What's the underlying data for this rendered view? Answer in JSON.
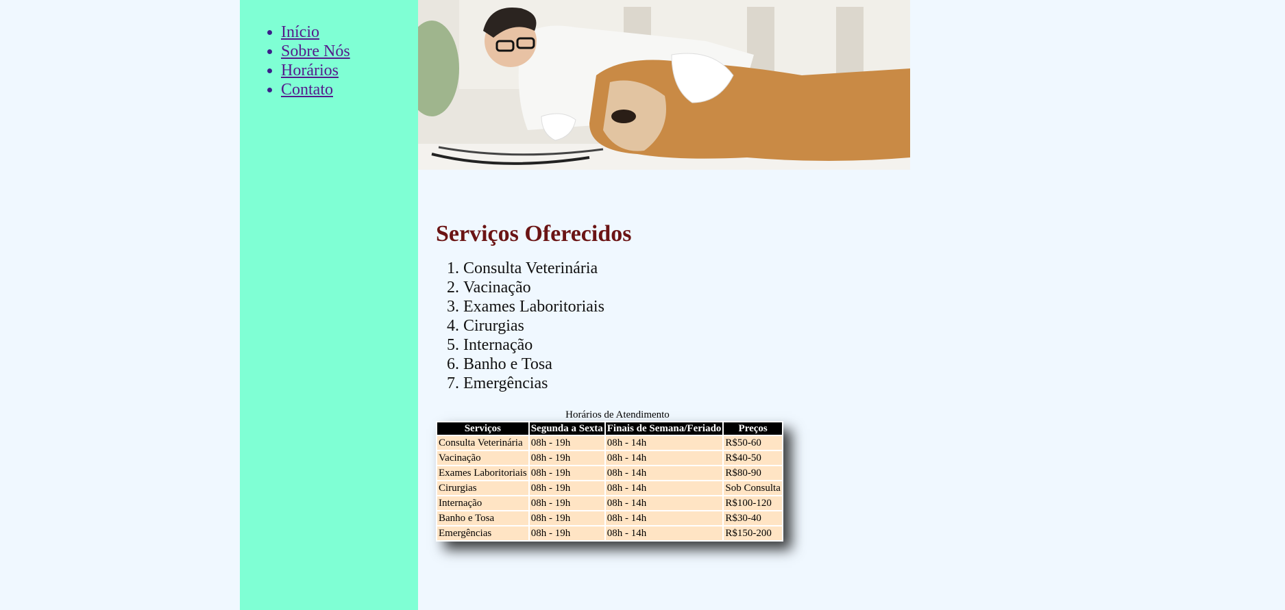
{
  "nav": {
    "items": [
      {
        "label": "Início"
      },
      {
        "label": "Sobre Nós"
      },
      {
        "label": "Horários"
      },
      {
        "label": "Contato"
      }
    ]
  },
  "colors": {
    "sidebar": "#7fffd4",
    "page_background": "#f0f8ff",
    "heading": "#6b1414",
    "table_header": "#000000",
    "table_cell": "#ffe4c4"
  },
  "services": {
    "title": "Serviços Oferecidos",
    "items": [
      "Consulta Veterinária",
      "Vacinação",
      "Exames Laboritoriais",
      "Cirurgias",
      "Internação",
      "Banho e Tosa",
      "Emergências"
    ]
  },
  "schedule": {
    "caption": "Horários de Atendimento",
    "headers": [
      "Serviços",
      "Segunda a Sexta",
      "Finais de Semana/Feriado",
      "Preços"
    ],
    "rows": [
      [
        "Consulta Veterinária",
        "08h - 19h",
        "08h - 14h",
        "R$50-60"
      ],
      [
        "Vacinação",
        "08h - 19h",
        "08h - 14h",
        "R$40-50"
      ],
      [
        "Exames Laboritoriais",
        "08h - 19h",
        "08h - 14h",
        "R$80-90"
      ],
      [
        "Cirurgias",
        "08h - 19h",
        "08h - 14h",
        "Sob Consulta"
      ],
      [
        "Internação",
        "08h - 19h",
        "08h - 14h",
        "R$100-120"
      ],
      [
        "Banho e Tosa",
        "08h - 19h",
        "08h - 14h",
        "R$30-40"
      ],
      [
        "Emergências",
        "08h - 19h",
        "08h - 14h",
        "R$150-200"
      ]
    ]
  }
}
